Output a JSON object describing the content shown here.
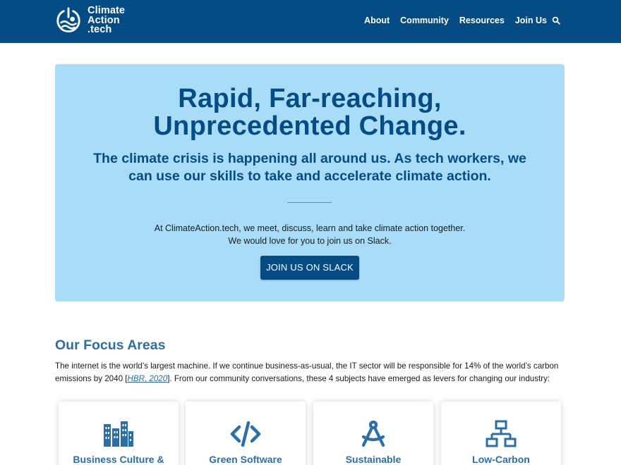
{
  "header": {
    "logo_lines": [
      "Climate",
      "Action",
      ".tech"
    ],
    "nav": [
      "About",
      "Community",
      "Resources",
      "Join Us"
    ],
    "search_icon": "search-icon",
    "background": "#054c85"
  },
  "hero": {
    "title_line1": "Rapid, Far-reaching,",
    "title_line2": "Unprecedented Change.",
    "subtitle_line1": "The climate crisis is happening all around us. As tech workers, we",
    "subtitle_line2": "can use our skills to take and accelerate climate action.",
    "text_line1": "At ClimateAction.tech, we meet, discuss, learn and take climate action together.",
    "text_line2": "We would love for you to join us on Slack.",
    "button": "JOIN US ON SLACK",
    "background": "#a8dcf7",
    "accent": "#054c85"
  },
  "focus": {
    "title": "Our Focus Areas",
    "text_before": "The internet is the world’s largest machine. If we continue business-as-usual, the IT sector will be responsible for 14% of the world’s carbon emissions by 2040 [",
    "link": "HBR, 2020",
    "text_after": "]. From our community conversations, these 4 subjects have emerged as levers for changing our industry:",
    "cards": [
      {
        "title": "Business Culture &",
        "icon": "building-icon"
      },
      {
        "title": "Green Software",
        "icon": "code-icon"
      },
      {
        "title": "Sustainable",
        "icon": "compass-icon"
      },
      {
        "title": "Low-Carbon",
        "icon": "network-icon"
      }
    ],
    "accent": "#2b6ea8"
  }
}
